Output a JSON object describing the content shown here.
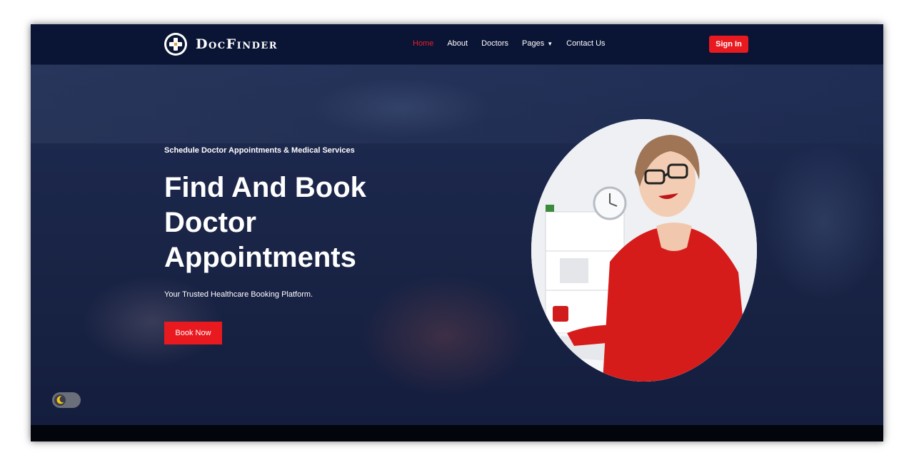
{
  "brand": {
    "name": "DocFinder",
    "logo_icon": "medical-cross-icon"
  },
  "nav": {
    "items": [
      {
        "label": "Home",
        "active": true
      },
      {
        "label": "About",
        "active": false
      },
      {
        "label": "Doctors",
        "active": false
      },
      {
        "label": "Pages",
        "active": false,
        "has_dropdown": true
      },
      {
        "label": "Contact Us",
        "active": false
      }
    ],
    "signin_label": "Sign In"
  },
  "hero": {
    "subtitle": "Schedule Doctor Appointments & Medical Services",
    "headline_lines": [
      "Find And Book",
      "Doctor",
      "Appointments"
    ],
    "tagline": "Your Trusted Healthcare Booking Platform.",
    "cta_label": "Book Now"
  },
  "theme_toggle": {
    "icon": "moon-icon"
  },
  "colors": {
    "accent": "#e8191f",
    "nav_bg": "#0a1434",
    "hero_bg": "#1a2547",
    "active_link": "#e8202a"
  }
}
